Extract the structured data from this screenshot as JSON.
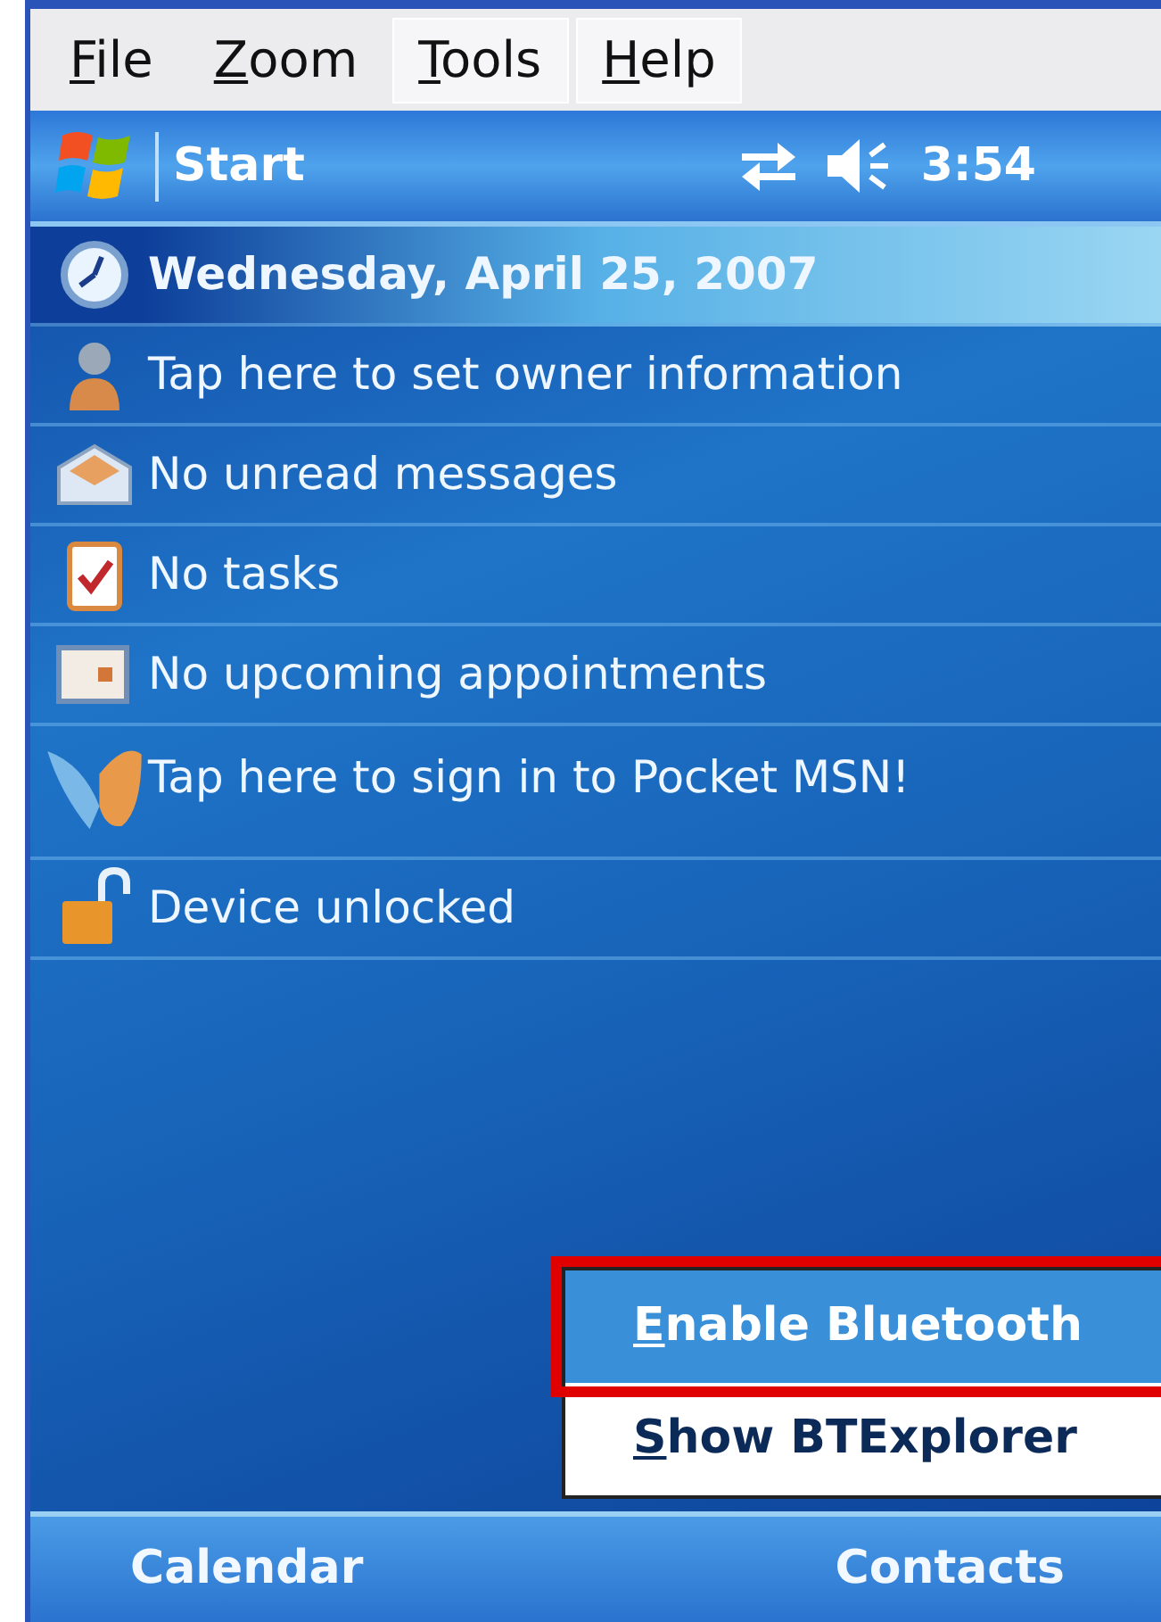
{
  "menu_bar": [
    {
      "label": "File",
      "selected": false
    },
    {
      "label": "Zoom",
      "selected": false
    },
    {
      "label": "Tools",
      "selected": true
    },
    {
      "label": "Help",
      "selected": true
    }
  ],
  "taskbar": {
    "start": "Start",
    "time": "3:54"
  },
  "today_items": [
    {
      "kind": "date",
      "text": "Wednesday, April 25, 2007"
    },
    {
      "kind": "owner",
      "text": "Tap here to set owner information"
    },
    {
      "kind": "messages",
      "text": "No unread messages"
    },
    {
      "kind": "tasks",
      "text": "No tasks"
    },
    {
      "kind": "appointments",
      "text": "No upcoming appointments"
    },
    {
      "kind": "msn",
      "text": "Tap here to sign in to Pocket MSN!"
    },
    {
      "kind": "lock",
      "text": "Device unlocked"
    }
  ],
  "popup_menu": [
    {
      "label": "Enable Bluetooth",
      "selected": true,
      "annotated": true
    },
    {
      "label": "Show BTExplorer",
      "selected": false,
      "annotated": false
    }
  ],
  "softkeys": [
    "Calendar",
    "Contacts"
  ]
}
